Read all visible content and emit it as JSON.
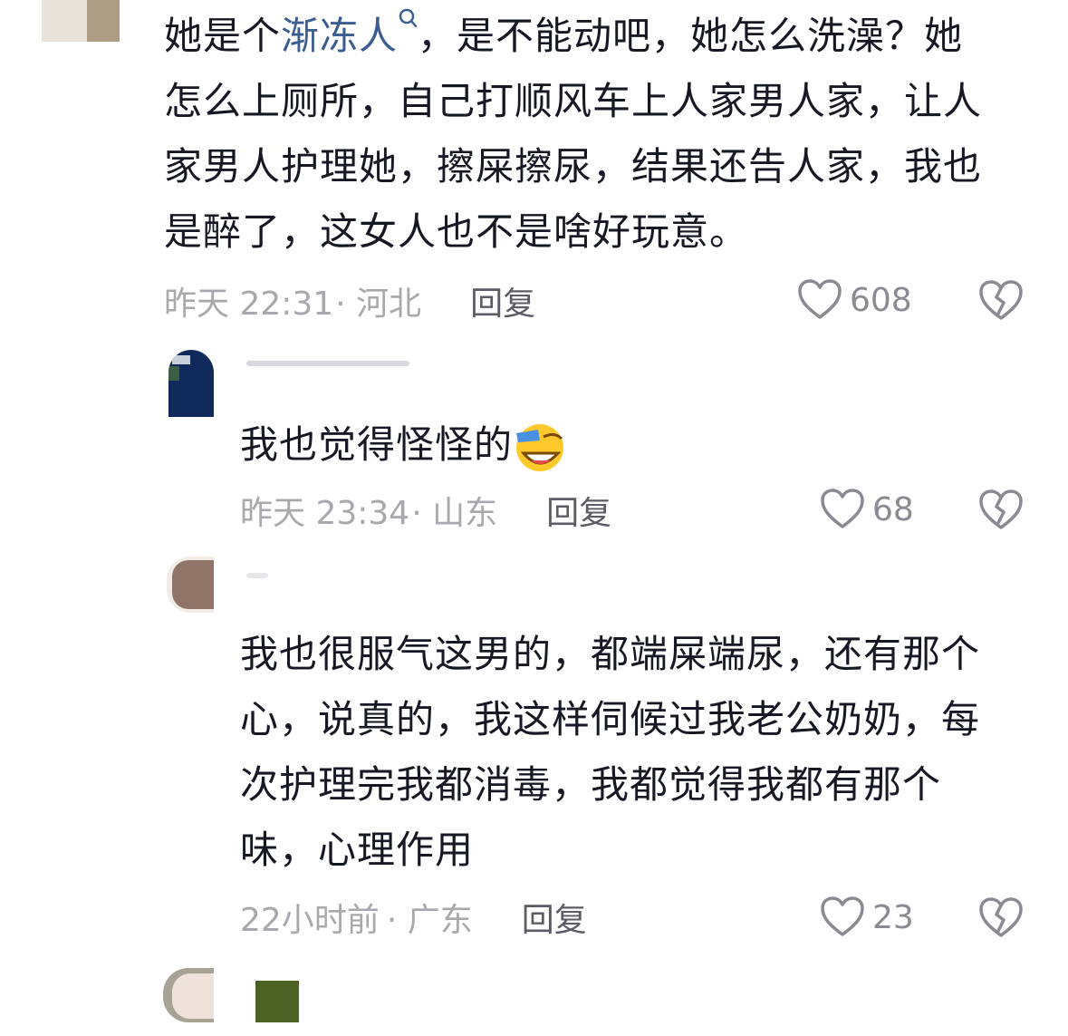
{
  "comments": [
    {
      "text_before_link": "她是个",
      "link_text": "渐冻人",
      "text_after_link": "，是不能动吧，她怎么洗澡？她",
      "line2": "怎么上厕所，自己打顺风车上人家男人家，让人",
      "line3": "家男人护理她，擦屎擦尿，结果还告人家，我也",
      "line4": "是醉了，这女人也不是啥好玩意。",
      "time": "昨天 22:31",
      "location": "· 河北",
      "reply_label": "回复",
      "likes": "608"
    },
    {
      "text": "我也觉得怪怪的",
      "time": "昨天 23:34",
      "location": "· 山东",
      "reply_label": "回复",
      "likes": "68"
    },
    {
      "line1": "我也很服气这男的，都端屎端尿，还有那个",
      "line2": "心，说真的，我这样伺候过我老公奶奶，每",
      "line3": "次护理完我都消毒，我都觉得我都有那个",
      "line4": "味，心理作用",
      "time": "22小时前",
      "location": "· 广东",
      "reply_label": "回复",
      "likes": "23"
    }
  ],
  "colors": {
    "text": "#161823",
    "meta": "#a8a8ae",
    "reply": "#5c5c66",
    "link": "#3b5d8f",
    "icon": "#8a8a92"
  },
  "icons": {
    "like": "heart-outline-icon",
    "dislike": "broken-heart-icon",
    "link_search": "search-icon",
    "emoji": "laugh-cry-emoji"
  }
}
